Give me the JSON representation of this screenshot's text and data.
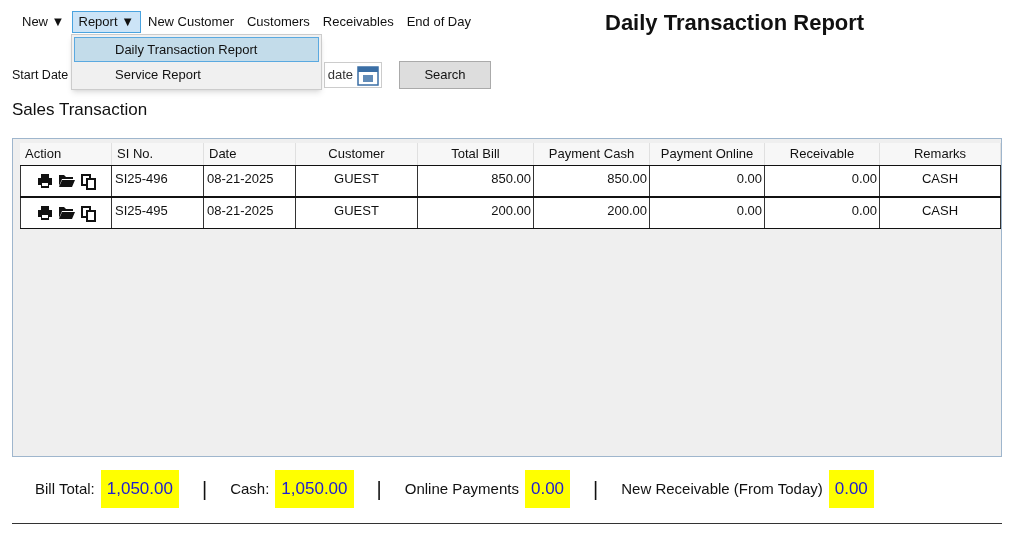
{
  "menu": [
    {
      "label": "New",
      "dropdown": true,
      "selected": false
    },
    {
      "label": "Report",
      "dropdown": true,
      "selected": true
    },
    {
      "label": "New Customer",
      "dropdown": false,
      "selected": false
    },
    {
      "label": "Customers",
      "dropdown": false,
      "selected": false
    },
    {
      "label": "Receivables",
      "dropdown": false,
      "selected": false
    },
    {
      "label": "End of Day",
      "dropdown": false,
      "selected": false
    }
  ],
  "dropdown_arrow": "▼",
  "report_menu": [
    {
      "label": "Daily Transaction Report",
      "selected": true
    },
    {
      "label": "Service Report",
      "selected": false
    }
  ],
  "title": "Daily Transaction Report",
  "filters": {
    "start_label": "Start Date",
    "end_date_text": "date",
    "search_button": "Search"
  },
  "section_title": "Sales Transaction",
  "table": {
    "columns": [
      "Action",
      "SI No.",
      "Date",
      "Customer",
      "Total Bill",
      "Payment Cash",
      "Payment Online",
      "Receivable",
      "Remarks"
    ],
    "rows": [
      [
        "",
        "SI25-496",
        "08-21-2025",
        "GUEST",
        "850.00",
        "850.00",
        "0.00",
        "0.00",
        "CASH"
      ],
      [
        "",
        "SI25-495",
        "08-21-2025",
        "GUEST",
        "200.00",
        "200.00",
        "0.00",
        "0.00",
        "CASH"
      ]
    ]
  },
  "totals": [
    {
      "label": "Bill Total:",
      "value": "1,050.00"
    },
    {
      "label": "Cash:",
      "value": "1,050.00"
    },
    {
      "label": "Online Payments",
      "value": "0.00"
    },
    {
      "label": "New Receivable (From Today)",
      "value": "0.00"
    }
  ],
  "separator": "|"
}
